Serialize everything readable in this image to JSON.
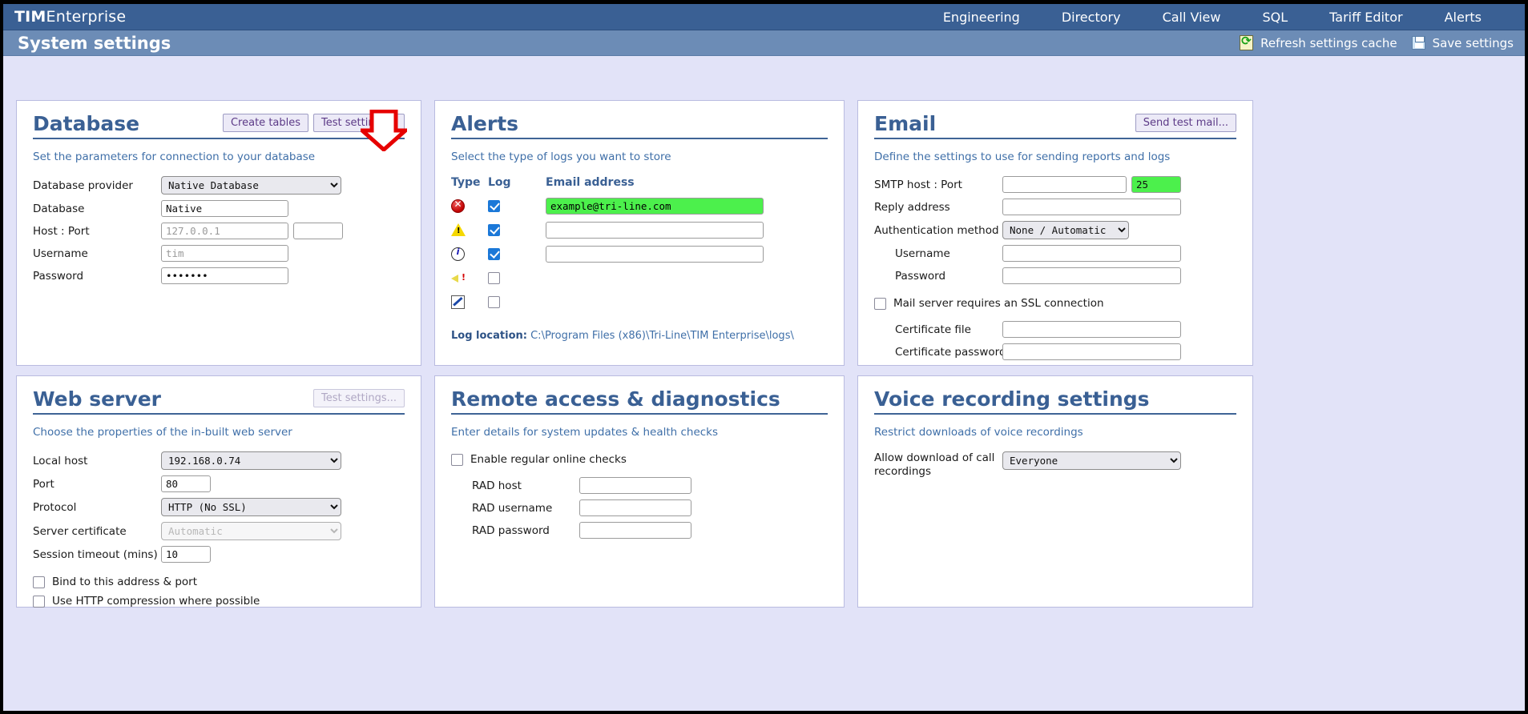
{
  "app": {
    "brand_bold": "TIM",
    "brand_light": "Enterprise",
    "page_title": "System settings"
  },
  "topnav": {
    "items": [
      {
        "label": "Engineering"
      },
      {
        "label": "Directory"
      },
      {
        "label": "Call View"
      },
      {
        "label": "SQL"
      },
      {
        "label": "Tariff Editor"
      },
      {
        "label": "Alerts"
      }
    ]
  },
  "subactions": {
    "refresh_label": "Refresh settings cache",
    "save_label": "Save settings"
  },
  "database": {
    "title": "Database",
    "create_tables_label": "Create tables",
    "test_settings_label": "Test settings...",
    "subtitle": "Set the parameters for connection to your database",
    "labels": {
      "provider": "Database provider",
      "database": "Database",
      "host_port": "Host : Port",
      "username": "Username",
      "password": "Password"
    },
    "provider_value": "Native Database",
    "provider_options": [
      "Native Database"
    ],
    "database_value": "Native",
    "host_placeholder": "127.0.0.1",
    "host_value": "",
    "port_value": "",
    "username_placeholder": "tim",
    "username_value": "",
    "password_value": "••••••"
  },
  "alerts": {
    "title": "Alerts",
    "subtitle": "Select the type of logs you want to store",
    "columns": {
      "type": "Type",
      "log": "Log",
      "email": "Email address"
    },
    "rows": [
      {
        "icon": "error-icon",
        "checked": true,
        "email": "example@tri-line.com",
        "highlight": true,
        "has_email_field": true
      },
      {
        "icon": "warning-icon",
        "checked": true,
        "email": "",
        "highlight": false,
        "has_email_field": true
      },
      {
        "icon": "info-icon",
        "checked": true,
        "email": "",
        "highlight": false,
        "has_email_field": true
      },
      {
        "icon": "sound-alert-icon",
        "checked": false,
        "email": "",
        "highlight": false,
        "has_email_field": false
      },
      {
        "icon": "debug-pen-icon",
        "checked": false,
        "email": "",
        "highlight": false,
        "has_email_field": false
      }
    ],
    "log_location_label": "Log location:",
    "log_location_path": "C:\\Program Files (x86)\\Tri-Line\\TIM Enterprise\\logs\\"
  },
  "email": {
    "title": "Email",
    "send_test_label": "Send test mail...",
    "subtitle": "Define the settings to use for sending reports and logs",
    "labels": {
      "smtp_host_port": "SMTP host : Port",
      "reply_address": "Reply address",
      "auth_method": "Authentication method",
      "username": "Username",
      "password": "Password",
      "ssl_checkbox": "Mail server requires an SSL connection",
      "cert_file": "Certificate file",
      "cert_password": "Certificate password"
    },
    "smtp_host_value": "",
    "smtp_port_value": "25",
    "smtp_port_highlight": true,
    "reply_address_value": "",
    "auth_method_value": "None / Automatic",
    "auth_method_options": [
      "None / Automatic"
    ],
    "username_value": "",
    "password_value": "",
    "ssl_checked": false,
    "cert_file_value": "",
    "cert_password_value": ""
  },
  "webserver": {
    "title": "Web server",
    "test_settings_label": "Test settings...",
    "test_settings_disabled": true,
    "subtitle": "Choose the properties of the in-built web server",
    "labels": {
      "local_host": "Local host",
      "port": "Port",
      "protocol": "Protocol",
      "server_certificate": "Server certificate",
      "session_timeout": "Session timeout (mins)",
      "bind": "Bind to this address & port",
      "compression": "Use HTTP compression where possible"
    },
    "local_host_value": "192.168.0.74",
    "local_host_options": [
      "192.168.0.74"
    ],
    "port_value": "80",
    "protocol_value": "HTTP (No SSL)",
    "protocol_options": [
      "HTTP (No SSL)"
    ],
    "server_certificate_value": "Automatic",
    "server_certificate_options": [
      "Automatic"
    ],
    "server_certificate_disabled": true,
    "session_timeout_value": "10",
    "bind_checked": false,
    "compression_checked": false
  },
  "remote": {
    "title": "Remote access & diagnostics",
    "subtitle": "Enter details for system updates & health checks",
    "labels": {
      "enable": "Enable regular online checks",
      "rad_host": "RAD host",
      "rad_username": "RAD username",
      "rad_password": "RAD password"
    },
    "enable_checked": false,
    "rad_host_value": "",
    "rad_username_value": "",
    "rad_password_value": ""
  },
  "voice": {
    "title": "Voice recording settings",
    "subtitle": "Restrict downloads of voice recordings",
    "label_allow_line1": "Allow download of call",
    "label_allow_line2": "recordings",
    "allow_value": "Everyone",
    "allow_options": [
      "Everyone"
    ]
  },
  "annotation": {
    "arrow_color": "#e60000",
    "arrow_target": "alerts-panel"
  }
}
